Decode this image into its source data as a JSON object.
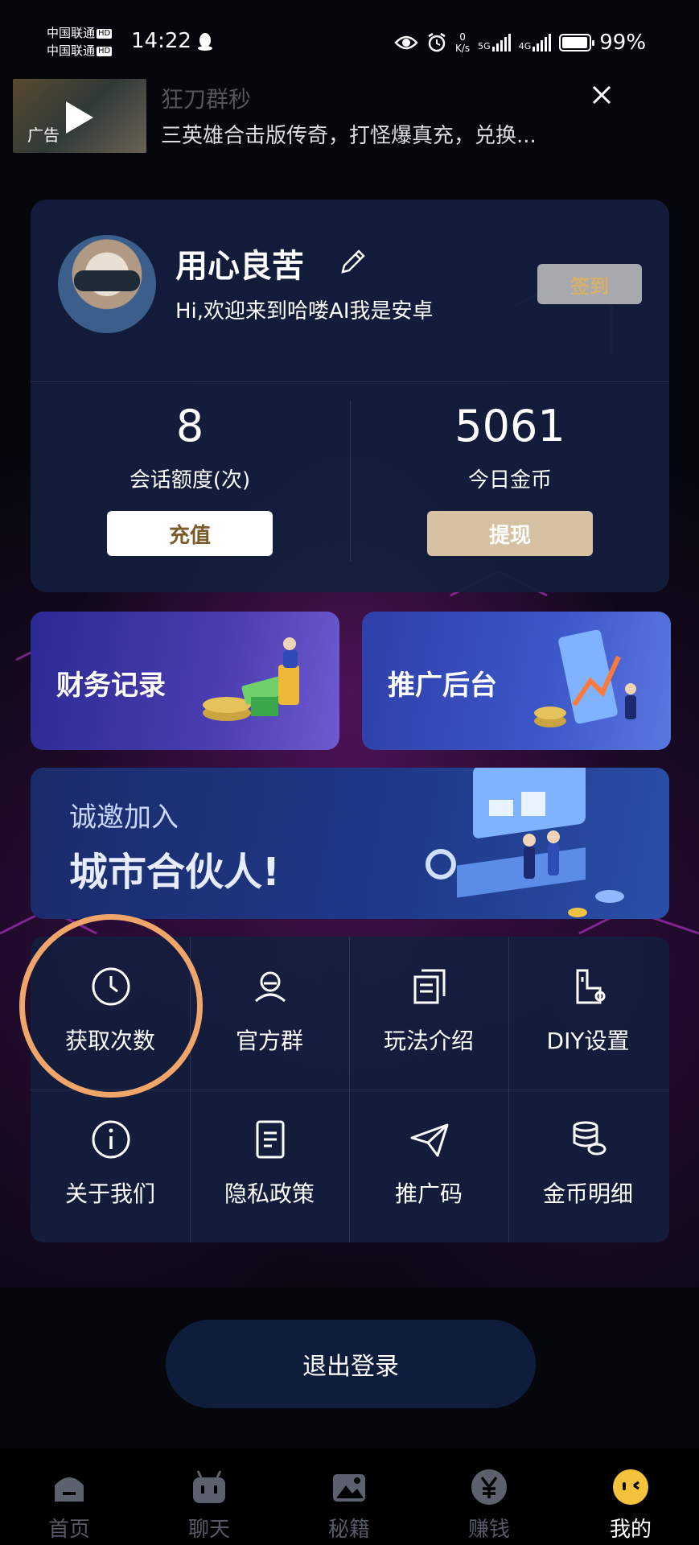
{
  "status_bar": {
    "carrier1": "中国联通",
    "carrier2": "中国联通",
    "hd": "HD",
    "time": "14:22",
    "net_speed_value": "0",
    "net_speed_unit": "K/s",
    "signal1_label": "5G",
    "signal2_label": "4G",
    "battery": "99%"
  },
  "ad": {
    "tag": "广告",
    "title": "狂刀群秒",
    "desc": "三英雄合击版传奇，打怪爆真充，兑换..."
  },
  "profile": {
    "username": "用心良苦",
    "welcome": "Hi,欢迎来到哈喽AI我是安卓",
    "signin_label": "签到",
    "stats": [
      {
        "value": "8",
        "label": "会话额度(次)",
        "button": "充值"
      },
      {
        "value": "5061",
        "label": "今日金币",
        "button": "提现"
      }
    ]
  },
  "tiles": [
    {
      "label": "财务记录"
    },
    {
      "label": "推广后台"
    }
  ],
  "partner": {
    "line1": "诚邀加入",
    "line2": "城市合伙人!"
  },
  "menu": [
    {
      "label": "获取次数",
      "icon": "clock-icon"
    },
    {
      "label": "官方群",
      "icon": "user-headset-icon"
    },
    {
      "label": "玩法介绍",
      "icon": "copy-doc-icon"
    },
    {
      "label": "DIY设置",
      "icon": "diy-settings-icon"
    },
    {
      "label": "关于我们",
      "icon": "info-icon"
    },
    {
      "label": "隐私政策",
      "icon": "document-icon"
    },
    {
      "label": "推广码",
      "icon": "paper-plane-icon"
    },
    {
      "label": "金币明细",
      "icon": "coins-stack-icon"
    }
  ],
  "logout_label": "退出登录",
  "nav": [
    {
      "label": "首页",
      "icon": "home-icon"
    },
    {
      "label": "聊天",
      "icon": "robot-chat-icon"
    },
    {
      "label": "秘籍",
      "icon": "image-icon"
    },
    {
      "label": "赚钱",
      "icon": "yen-coin-icon"
    },
    {
      "label": "我的",
      "icon": "smiley-icon",
      "active": true
    }
  ]
}
